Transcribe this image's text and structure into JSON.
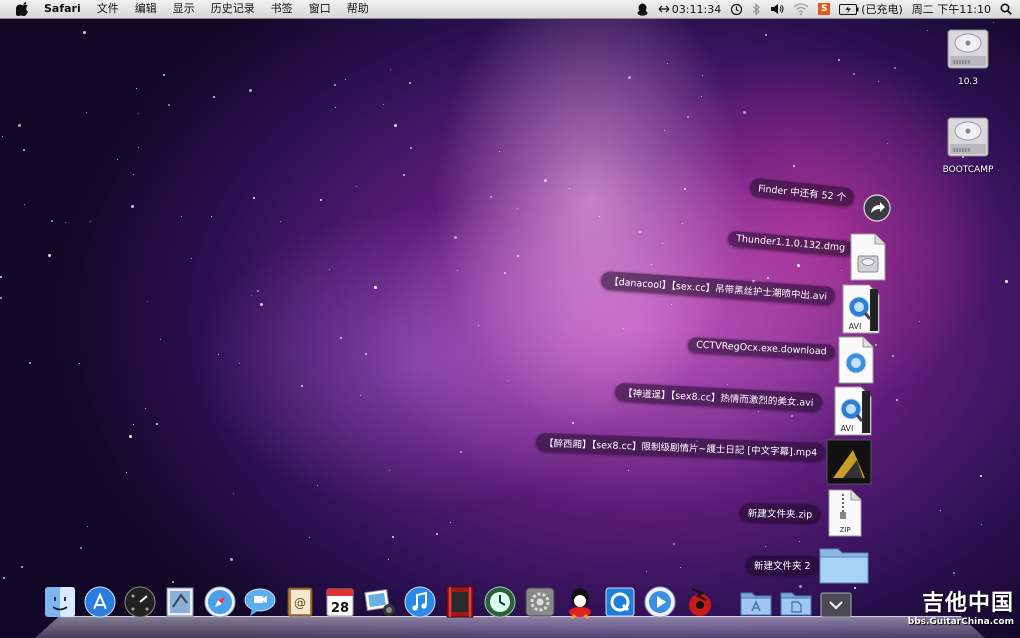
{
  "menubar": {
    "app_name": "Safari",
    "menus": [
      "文件",
      "编辑",
      "显示",
      "历史记录",
      "书签",
      "窗口",
      "帮助"
    ],
    "timer": "03:11:34",
    "battery": "(已充电)",
    "clock": "周二 下午11:10",
    "input_method": "S"
  },
  "desktop_icons": [
    {
      "label": "10.3",
      "icon": "hard-drive-icon"
    },
    {
      "label": "BOOTCAMP",
      "icon": "hard-drive-icon"
    }
  ],
  "stack": {
    "header": "Finder 中还有 52 个",
    "items": [
      {
        "label": "Thunder1.1.0.132.dmg",
        "icon": "dmg-file-icon"
      },
      {
        "label": "【danacool】【sex.cc】吊带黑丝护士潮喷中出.avi",
        "icon": "avi-file-icon",
        "badge": "AVI"
      },
      {
        "label": "CCTVRegOcx.exe.download",
        "icon": "download-file-icon"
      },
      {
        "label": "【神道逞】【sex8.cc】热情而激烈的美女.avi",
        "icon": "avi-file-icon",
        "badge": "AVI"
      },
      {
        "label": "【醉西厢】【sex8.cc】限制级剧情片~護士日記 [中文字幕].mp4",
        "icon": "mp4-file-icon"
      },
      {
        "label": "新建文件夹.zip",
        "icon": "zip-file-icon",
        "badge": "ZIP"
      },
      {
        "label": "新建文件夹 2",
        "icon": "folder-icon"
      }
    ]
  },
  "dock": {
    "items": [
      "finder-icon",
      "app-store-icon",
      "dashboard-icon",
      "mail-icon",
      "safari-icon",
      "ichat-icon",
      "address-book-icon",
      "ical-icon",
      "iphoto-icon",
      "itunes-icon",
      "photo-booth-icon",
      "time-machine-icon",
      "system-preferences-icon",
      "qq-icon",
      "quicktime-icon",
      "quicktime-player-icon",
      "thunder-icon",
      "applications-folder-icon",
      "documents-folder-icon",
      "downloads-stack-icon"
    ],
    "calendar_date": "28"
  },
  "watermark": {
    "title": "吉他中国",
    "url": "bbs.GuitarChina.com"
  },
  "colors": {
    "menubar": "#e4e4e4",
    "stack_label_bg": "#2a1230"
  }
}
